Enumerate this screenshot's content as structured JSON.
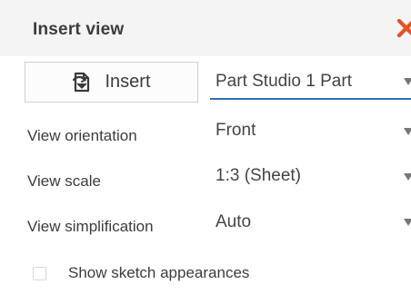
{
  "dialog": {
    "title": "Insert view",
    "close_icon": "close-icon",
    "accent_color": "#e8501d",
    "focus_color": "#2f6fb2"
  },
  "insert_button": {
    "label": "Insert",
    "icon": "insert-document-icon"
  },
  "source_select": {
    "value": "Part Studio 1 Part"
  },
  "fields": {
    "view_orientation": {
      "label": "View orientation",
      "value": "Front"
    },
    "view_scale": {
      "label": "View scale",
      "value": "1:3 (Sheet)"
    },
    "view_simplification": {
      "label": "View simplification",
      "value": "Auto"
    }
  },
  "options": {
    "show_sketch_appearances": {
      "label": "Show sketch appearances",
      "checked": false
    }
  }
}
